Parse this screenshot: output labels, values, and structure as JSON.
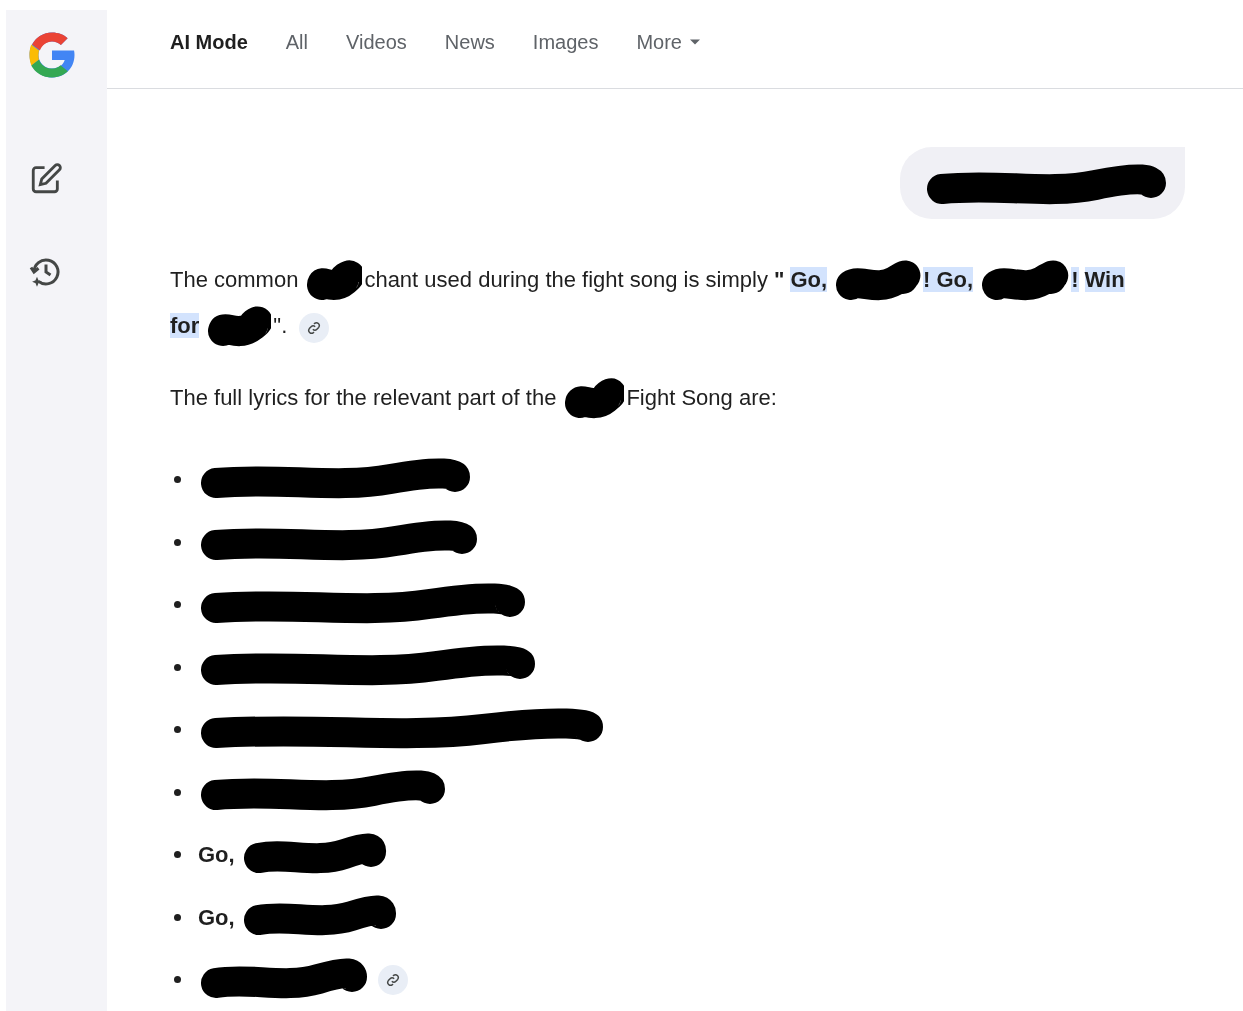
{
  "tabs": [
    {
      "label": "AI Mode",
      "selected": true
    },
    {
      "label": "All",
      "selected": false
    },
    {
      "label": "Videos",
      "selected": false
    },
    {
      "label": "News",
      "selected": false
    },
    {
      "label": "Images",
      "selected": false
    },
    {
      "label": "More",
      "selected": false,
      "dropdown": true
    }
  ],
  "query": {
    "segments": [
      {
        "kind": "redaction"
      }
    ]
  },
  "answer": [
    {
      "kind": "paragraph",
      "source_link": true,
      "segments": [
        {
          "kind": "text",
          "text": "The common",
          "bold": false,
          "highlight": false
        },
        {
          "kind": "redaction"
        },
        {
          "kind": "text",
          "text": "chant used during the fight song is simply",
          "bold": false,
          "highlight": false
        },
        {
          "kind": "text",
          "text": "\"",
          "bold": true,
          "highlight": false
        },
        {
          "kind": "text",
          "text": "Go,",
          "bold": true,
          "highlight": true
        },
        {
          "kind": "redaction"
        },
        {
          "kind": "text",
          "text": "! Go,",
          "bold": true,
          "highlight": true
        },
        {
          "kind": "redaction"
        },
        {
          "kind": "text",
          "text": "!",
          "bold": true,
          "highlight": true
        },
        {
          "kind": "text",
          "text": "Win for",
          "bold": true,
          "highlight": true
        },
        {
          "kind": "redaction"
        },
        {
          "kind": "text",
          "text": "\".",
          "bold": false,
          "highlight": false
        }
      ]
    },
    {
      "kind": "paragraph",
      "source_link": false,
      "segments": [
        {
          "kind": "text",
          "text": "The full lyrics for the relevant part of the",
          "bold": false,
          "highlight": false
        },
        {
          "kind": "redaction"
        },
        {
          "kind": "text",
          "text": "Fight Song are:",
          "bold": false,
          "highlight": false
        }
      ]
    },
    {
      "kind": "list",
      "items": [
        {
          "source_link": false,
          "segments": [
            {
              "kind": "redaction"
            }
          ]
        },
        {
          "source_link": false,
          "segments": [
            {
              "kind": "redaction"
            }
          ]
        },
        {
          "source_link": false,
          "segments": [
            {
              "kind": "redaction"
            }
          ]
        },
        {
          "source_link": false,
          "segments": [
            {
              "kind": "redaction"
            }
          ]
        },
        {
          "source_link": false,
          "segments": [
            {
              "kind": "redaction"
            }
          ]
        },
        {
          "source_link": false,
          "segments": [
            {
              "kind": "redaction"
            }
          ]
        },
        {
          "source_link": false,
          "segments": [
            {
              "kind": "text",
              "text": "Go,",
              "bold": true,
              "highlight": false
            },
            {
              "kind": "redaction"
            }
          ]
        },
        {
          "source_link": false,
          "segments": [
            {
              "kind": "text",
              "text": "Go,",
              "bold": true,
              "highlight": false
            },
            {
              "kind": "redaction"
            }
          ]
        },
        {
          "source_link": true,
          "segments": [
            {
              "kind": "redaction"
            }
          ]
        }
      ]
    }
  ]
}
